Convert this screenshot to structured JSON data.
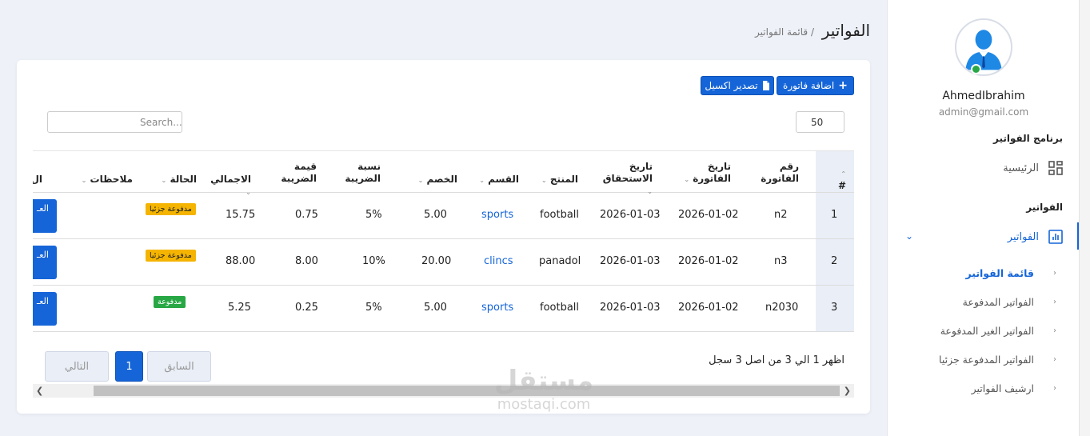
{
  "header": {
    "title": "الفواتير",
    "breadcrumb": "/ قائمة الفواتير"
  },
  "toolbar": {
    "add_label": "اضافة فاتورة",
    "excel_label": "تصدير اكسيل",
    "page_size": "50",
    "search_placeholder": "Search..."
  },
  "table": {
    "headers": {
      "idx": "#",
      "invoice_no": "رقم الفاتورة",
      "invoice_date": "تاريخ الفاتورة",
      "due_date": "تاريخ الاستحقاق",
      "product": "المنتج",
      "section": "القسم",
      "discount": "الخصم",
      "tax_rate": "نسبة الضريبة",
      "tax_value": "قيمة الضريبة",
      "total": "الاجمالي",
      "status": "الحالة",
      "notes": "ملاحظات",
      "actions": "ال"
    },
    "rows": [
      {
        "idx": "1",
        "invoice_no": "n2",
        "invoice_date": "2026-01-02",
        "due_date": "2026-01-03",
        "product": "football",
        "section": "sports",
        "discount": "5.00",
        "tax_rate": "5%",
        "tax_value": "0.75",
        "total": "15.75",
        "status": "مدفوعة جزئيا",
        "action": "العـ"
      },
      {
        "idx": "2",
        "invoice_no": "n3",
        "invoice_date": "2026-01-02",
        "due_date": "2026-01-03",
        "product": "panadol",
        "section": "clincs",
        "discount": "20.00",
        "tax_rate": "10%",
        "tax_value": "8.00",
        "total": "88.00",
        "status": "مدفوعة جزئيا",
        "action": "العـ"
      },
      {
        "idx": "3",
        "invoice_no": "n2030",
        "invoice_date": "2026-01-02",
        "due_date": "2026-01-03",
        "product": "football",
        "section": "sports",
        "discount": "5.00",
        "tax_rate": "5%",
        "tax_value": "0.25",
        "total": "5.25",
        "status": "مدفوعة",
        "action": "العـ"
      }
    ]
  },
  "pagination": {
    "info": "اظهر 1 الي 3 من اصل 3 سجل",
    "prev": "السابق",
    "current": "1",
    "next": "التالي"
  },
  "sidebar": {
    "user_name": "AhmedIbrahim",
    "user_email": "admin@gmail.com",
    "section_program": "برنامج الفواتير",
    "home": "الرئيسية",
    "section_invoices": "الفواتير",
    "invoices": "الفواتير",
    "sub_items": [
      "قائمة الفواتير",
      "الفواتير المدفوعة",
      "الفواتير الغير المدفوعة",
      "الفواتير المدفوعة جزئيا",
      "ارشيف الفواتير"
    ]
  },
  "watermark": {
    "arabic": "مستقل",
    "latin": "mostaqi.com"
  },
  "colors": {
    "primary": "#1565d8",
    "partial": "#f4b400",
    "paid": "#28a745",
    "background": "#eef1f8"
  }
}
